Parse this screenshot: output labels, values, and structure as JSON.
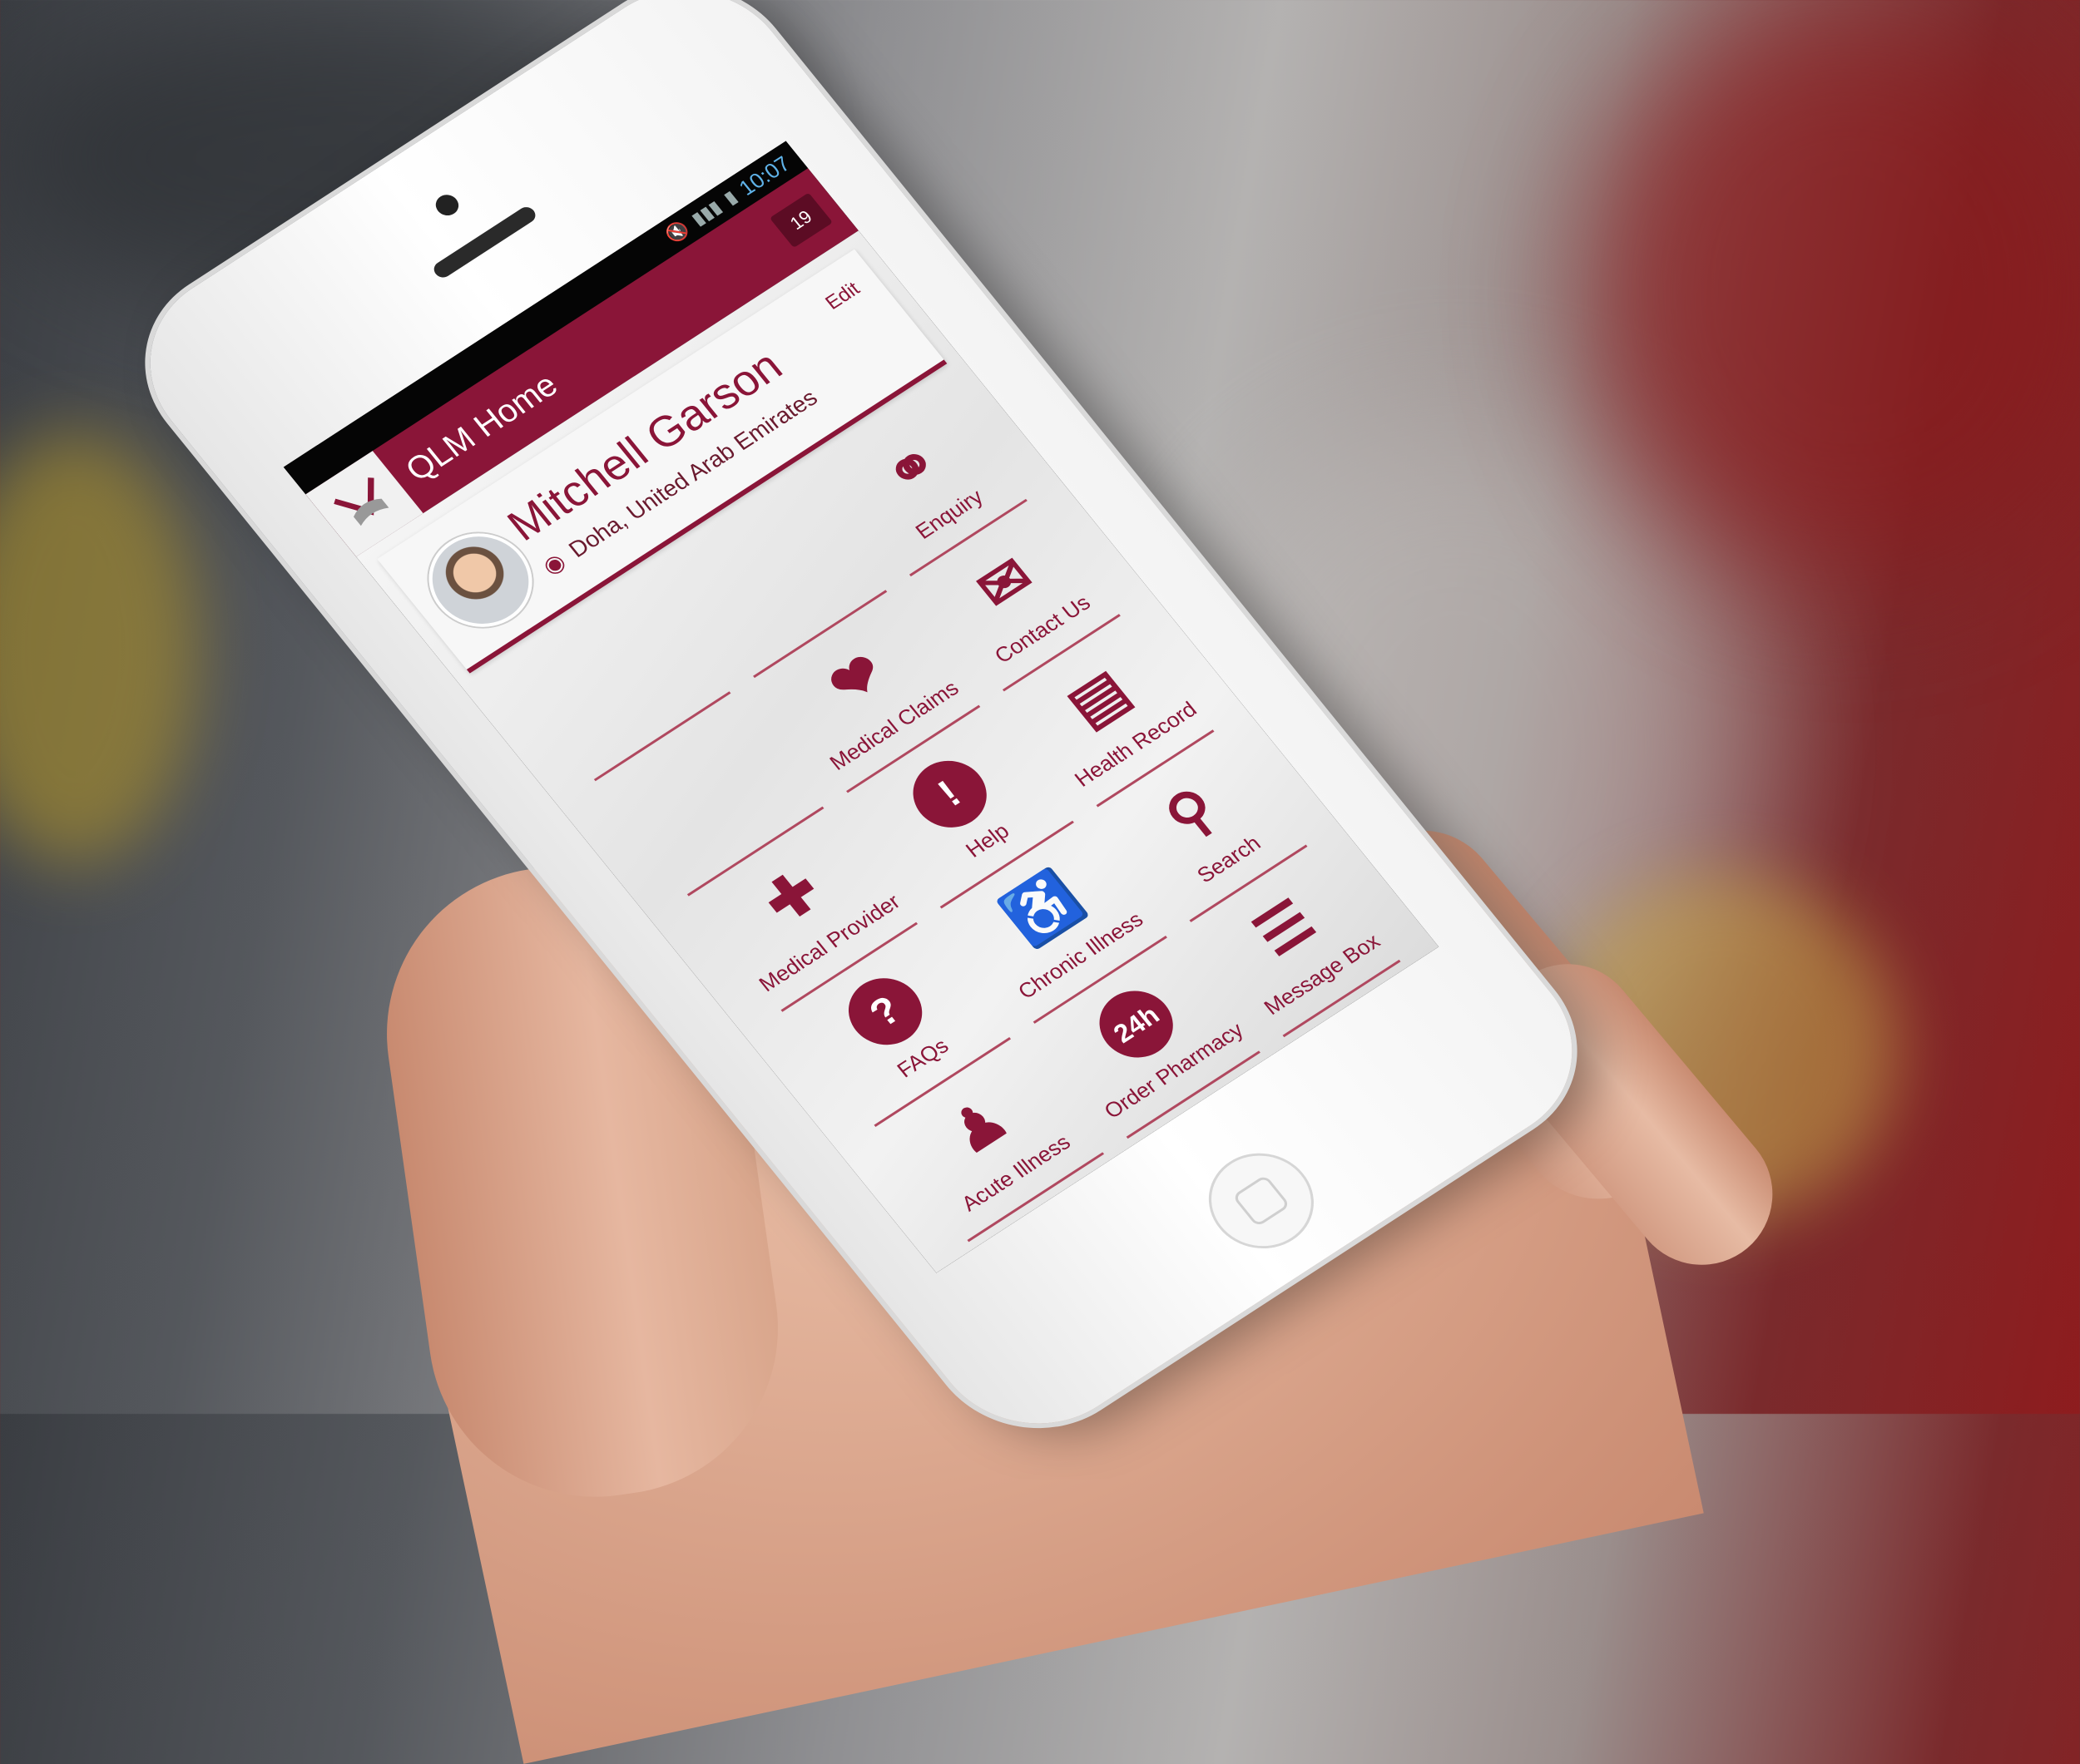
{
  "status_bar": {
    "time": "10:07"
  },
  "app": {
    "title": "QLM Home",
    "notification_count": "19"
  },
  "profile": {
    "name": "Mitchell Garson",
    "location": "Doha, United Arab Emirates",
    "edit_label": "Edit"
  },
  "tiles": [
    {
      "label": "",
      "icon": "blank"
    },
    {
      "label": "",
      "icon": "blank"
    },
    {
      "label": "Enquiry",
      "icon": "headphones-icon"
    },
    {
      "label": "",
      "icon": "blank"
    },
    {
      "label": "Medical Claims",
      "icon": "heart-pulse-icon"
    },
    {
      "label": "Contact Us",
      "icon": "envelope-icon"
    },
    {
      "label": "Medical Provider",
      "icon": "ambulance-icon"
    },
    {
      "label": "Help",
      "icon": "exclamation-bubble-icon"
    },
    {
      "label": "Health Record",
      "icon": "clipboard-icon"
    },
    {
      "label": "FAQs",
      "icon": "question-icon"
    },
    {
      "label": "Chronic Illness",
      "icon": "wheelchair-assist-icon"
    },
    {
      "label": "Search",
      "icon": "magnifier-icon"
    },
    {
      "label": "Acute Illness",
      "icon": "patient-icon"
    },
    {
      "label": "Order Pharmacy",
      "icon": "phone-24h-icon"
    },
    {
      "label": "Message Box",
      "icon": "message-icon"
    }
  ],
  "colors": {
    "brand": "#8a1538",
    "brand_dark": "#5c0c24",
    "status_text": "#5fb2e8"
  }
}
